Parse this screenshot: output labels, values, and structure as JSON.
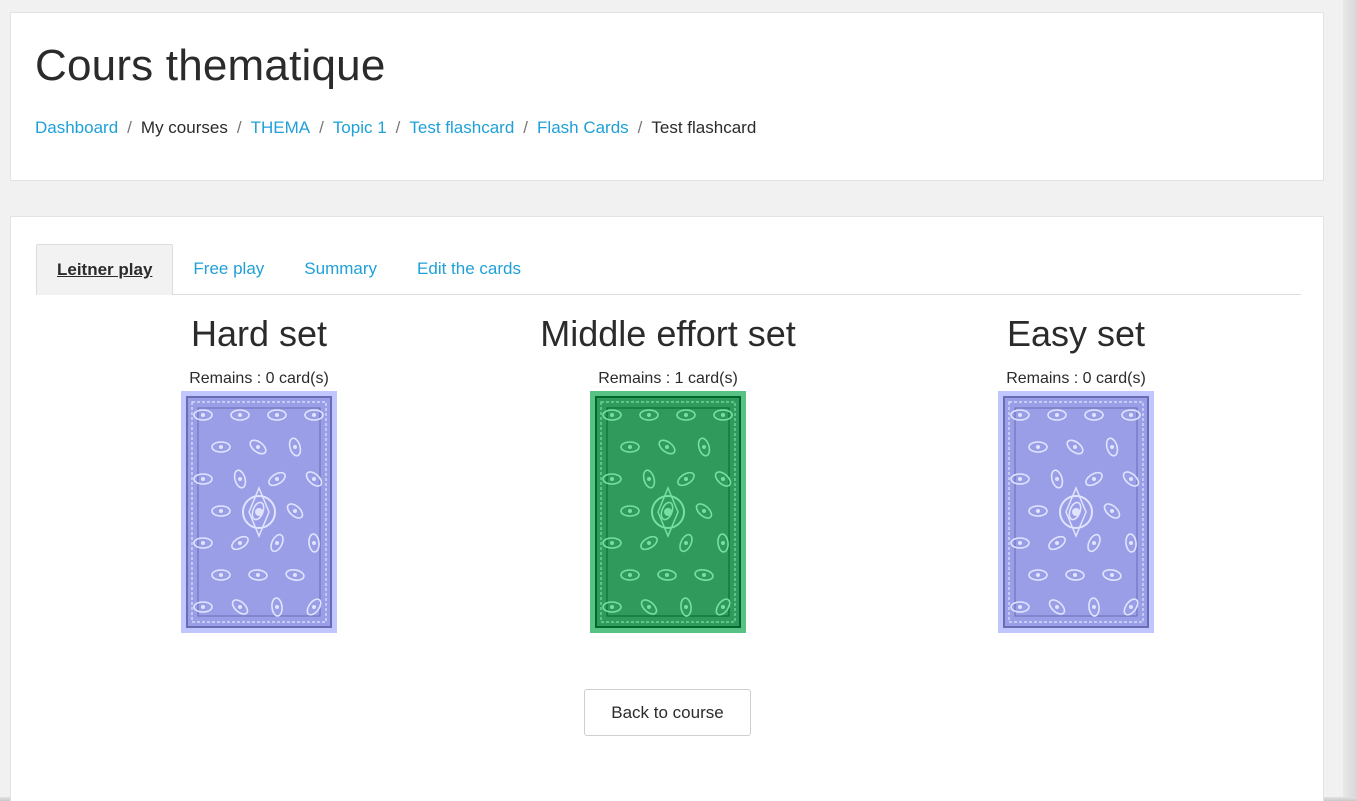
{
  "header": {
    "title": "Cours thematique",
    "breadcrumb": [
      {
        "label": "Dashboard",
        "link": true
      },
      {
        "label": "My courses",
        "link": false
      },
      {
        "label": "THEMA",
        "link": true
      },
      {
        "label": "Topic 1",
        "link": true
      },
      {
        "label": "Test flashcard",
        "link": true
      },
      {
        "label": "Flash Cards",
        "link": true
      },
      {
        "label": "Test flashcard",
        "link": false
      }
    ],
    "separator": "/"
  },
  "tabs": [
    {
      "label": "Leitner play",
      "active": true
    },
    {
      "label": "Free play",
      "active": false
    },
    {
      "label": "Summary",
      "active": false
    },
    {
      "label": "Edit the cards",
      "active": false
    }
  ],
  "decks": [
    {
      "title": "Hard set",
      "remains_label": "Remains :",
      "count": "0",
      "unit": "card(s)",
      "card_color": "#9a9ee6"
    },
    {
      "title": "Middle effort set",
      "remains_label": "Remains :",
      "count": "1",
      "unit": "card(s)",
      "card_color": "#2f9a5c"
    },
    {
      "title": "Easy set",
      "remains_label": "Remains :",
      "count": "0",
      "unit": "card(s)",
      "card_color": "#9a9ee6"
    }
  ],
  "back_button": {
    "label": "Back to course"
  }
}
